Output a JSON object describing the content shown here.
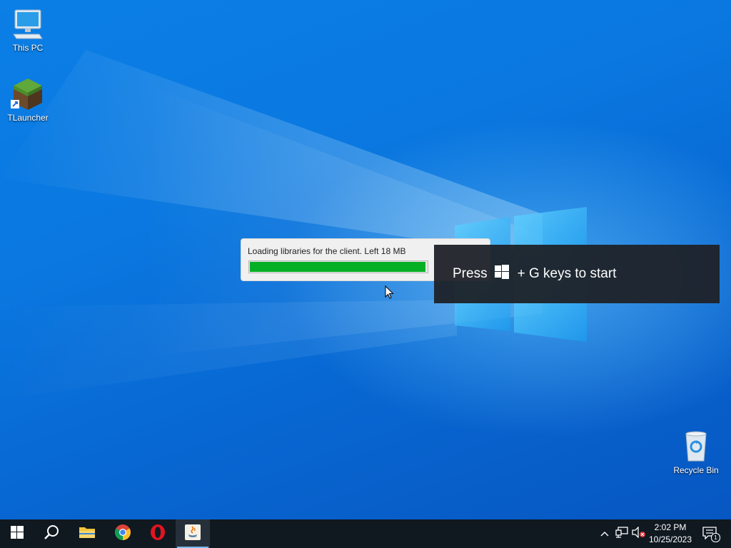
{
  "desktop": {
    "icons": [
      {
        "label": "This PC",
        "icon": "this-pc-icon"
      },
      {
        "label": "TLauncher",
        "icon": "tlauncher-icon"
      },
      {
        "label": "Recycle Bin",
        "icon": "recycle-bin-icon"
      }
    ]
  },
  "loader": {
    "message": "Loading libraries for the client. Left 18 MB",
    "progress_fraction": 0.99,
    "bar_color": "#06b025"
  },
  "gamebar_tip": {
    "prefix": "Press",
    "suffix": "+ G keys to start",
    "icon": "windows-logo-icon"
  },
  "taskbar": {
    "buttons": [
      {
        "name": "start",
        "icon": "windows-start-icon"
      },
      {
        "name": "search",
        "icon": "search-icon"
      },
      {
        "name": "file-explorer",
        "icon": "folder-icon"
      },
      {
        "name": "chrome",
        "icon": "chrome-icon"
      },
      {
        "name": "opera",
        "icon": "opera-icon"
      },
      {
        "name": "java",
        "icon": "java-icon",
        "active": true
      }
    ],
    "tray": {
      "icons": [
        "chevron-up-icon",
        "network-icon",
        "volume-muted-icon"
      ],
      "time": "2:02 PM",
      "date": "10/25/2023",
      "notification_count": "1"
    }
  },
  "colors": {
    "desktop_blue": "#0a78e0",
    "taskbar": "#101820",
    "gamebar_bg": "#1e2228"
  }
}
